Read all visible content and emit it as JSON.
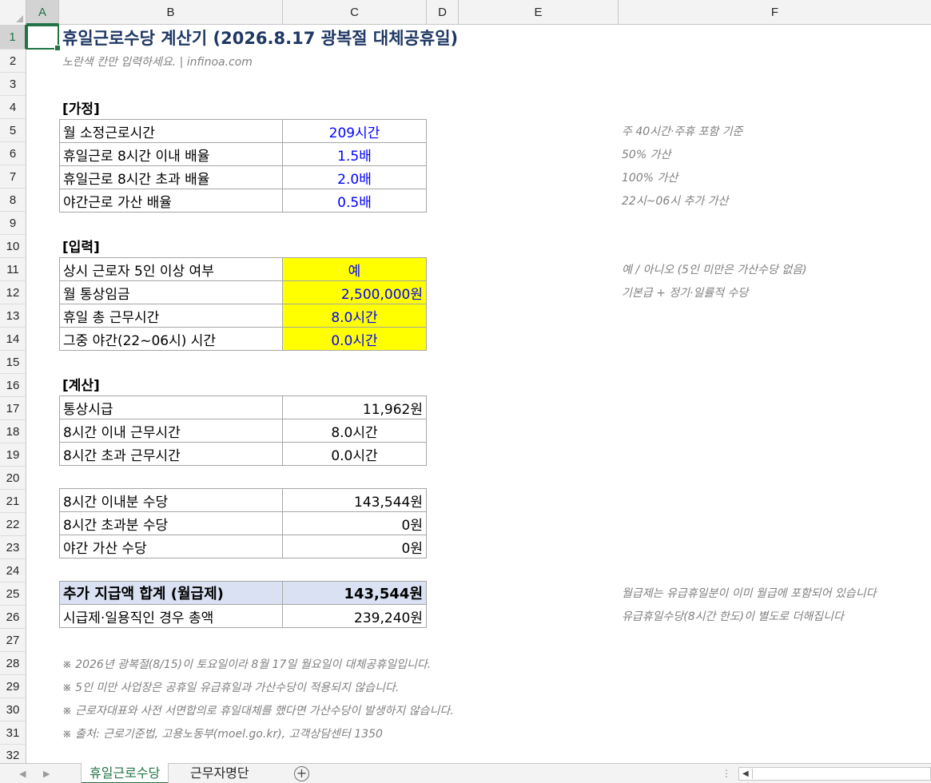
{
  "columns": [
    "A",
    "B",
    "C",
    "D",
    "E",
    "F"
  ],
  "rows": [
    "1",
    "2",
    "3",
    "4",
    "5",
    "6",
    "7",
    "8",
    "9",
    "10",
    "11",
    "12",
    "13",
    "14",
    "15",
    "16",
    "17",
    "18",
    "19",
    "20",
    "21",
    "22",
    "23",
    "24",
    "25",
    "26",
    "27",
    "28",
    "29",
    "30",
    "31",
    "32"
  ],
  "title": "휴일근로수당 계산기 (2026.8.17 광복절 대체공휴일)",
  "subtitle": "노란색 칸만 입력하세요.  |  infinoa.com",
  "sections": {
    "assumptions": "[가정]",
    "inputs": "[입력]",
    "calc": "[계산]"
  },
  "assumptions": [
    {
      "label": "월 소정근로시간",
      "value": "209시간",
      "note": "주 40시간·주휴 포함 기준"
    },
    {
      "label": "휴일근로 8시간 이내 배율",
      "value": "1.5배",
      "note": "50% 가산"
    },
    {
      "label": "휴일근로 8시간 초과 배율",
      "value": "2.0배",
      "note": "100% 가산"
    },
    {
      "label": "야간근로 가산 배율",
      "value": "0.5배",
      "note": "22시~06시 추가 가산"
    }
  ],
  "inputs": [
    {
      "label": "상시 근로자 5인 이상 여부",
      "value": "예",
      "note": "예 / 아니오  (5인 미만은 가산수당 없음)"
    },
    {
      "label": "월 통상임금",
      "value": "2,500,000원",
      "note": "기본급 + 정기·일률적 수당"
    },
    {
      "label": "휴일 총 근무시간",
      "value": "8.0시간",
      "note": ""
    },
    {
      "label": "그중 야간(22~06시) 시간",
      "value": "0.0시간",
      "note": ""
    }
  ],
  "calc": [
    {
      "label": "통상시급",
      "value": "11,962원"
    },
    {
      "label": "8시간 이내 근무시간",
      "value": "8.0시간"
    },
    {
      "label": "8시간 초과 근무시간",
      "value": "0.0시간"
    }
  ],
  "allowances": [
    {
      "label": "8시간 이내분 수당",
      "value": "143,544원"
    },
    {
      "label": "8시간 초과분 수당",
      "value": "0원"
    },
    {
      "label": "야간 가산 수당",
      "value": "0원"
    }
  ],
  "total": {
    "label": "추가 지급액 합계 (월급제)",
    "value": "143,544원",
    "note": "월급제는 유급휴일분이 이미 월급에 포함되어 있습니다"
  },
  "hourly_total": {
    "label": "시급제·일용직인 경우 총액",
    "value": "239,240원",
    "note": "유급휴일수당(8시간 한도)이 별도로 더해집니다"
  },
  "footnotes": [
    "※ 2026년 광복절(8/15)이 토요일이라 8월 17일 월요일이 대체공휴일입니다.",
    "※ 5인 미만 사업장은 공휴일 유급휴일과 가산수당이 적용되지 않습니다.",
    "※ 근로자대표와 사전 서면합의로 휴일대체를 했다면 가산수당이 발생하지 않습니다.",
    "※ 출처: 근로기준법, 고용노동부(moel.go.kr), 고객상담센터 1350"
  ],
  "sheet_tabs": [
    "휴일근로수당",
    "근무자명단"
  ],
  "add_sheet": "+",
  "colors": {
    "accent": "#217346",
    "input_fill": "#ffff00",
    "total_fill": "#d9e1f2",
    "title": "#1f3864",
    "value_blue": "#0000ff"
  }
}
